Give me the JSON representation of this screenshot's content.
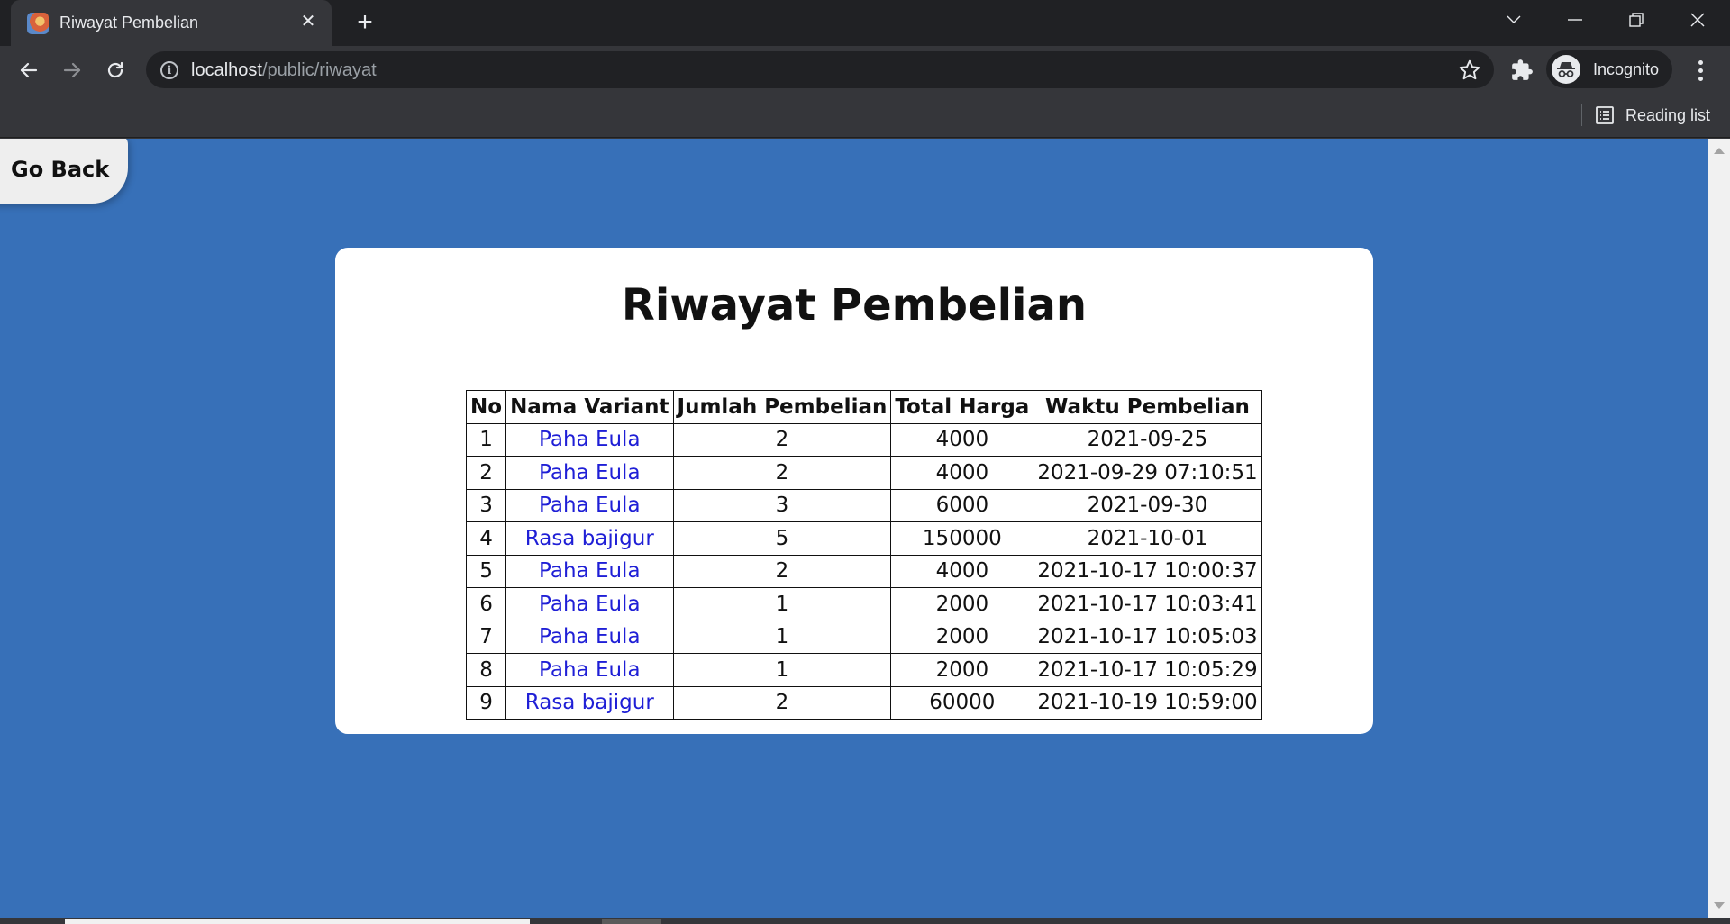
{
  "browser": {
    "tab_title": "Riwayat Pembelian",
    "url_host": "localhost",
    "url_path": "/public/riwayat",
    "profile_label": "Incognito",
    "reading_list_label": "Reading list"
  },
  "page": {
    "go_back_label": "Go Back",
    "title": "Riwayat Pembelian",
    "table": {
      "headers": [
        "No",
        "Nama Variant",
        "Jumlah Pembelian",
        "Total Harga",
        "Waktu Pembelian"
      ],
      "rows": [
        [
          "1",
          "Paha Eula",
          "2",
          "4000",
          "2021-09-25"
        ],
        [
          "2",
          "Paha Eula",
          "2",
          "4000",
          "2021-09-29 07:10:51"
        ],
        [
          "3",
          "Paha Eula",
          "3",
          "6000",
          "2021-09-30"
        ],
        [
          "4",
          "Rasa bajigur",
          "5",
          "150000",
          "2021-10-01"
        ],
        [
          "5",
          "Paha Eula",
          "2",
          "4000",
          "2021-10-17 10:00:37"
        ],
        [
          "6",
          "Paha Eula",
          "1",
          "2000",
          "2021-10-17 10:03:41"
        ],
        [
          "7",
          "Paha Eula",
          "1",
          "2000",
          "2021-10-17 10:05:03"
        ],
        [
          "8",
          "Paha Eula",
          "1",
          "2000",
          "2021-10-17 10:05:29"
        ],
        [
          "9",
          "Rasa bajigur",
          "2",
          "60000",
          "2021-10-19 10:59:00"
        ]
      ]
    }
  },
  "colors": {
    "page_background": "#3770b8",
    "link_text": "#1f1fd6"
  }
}
